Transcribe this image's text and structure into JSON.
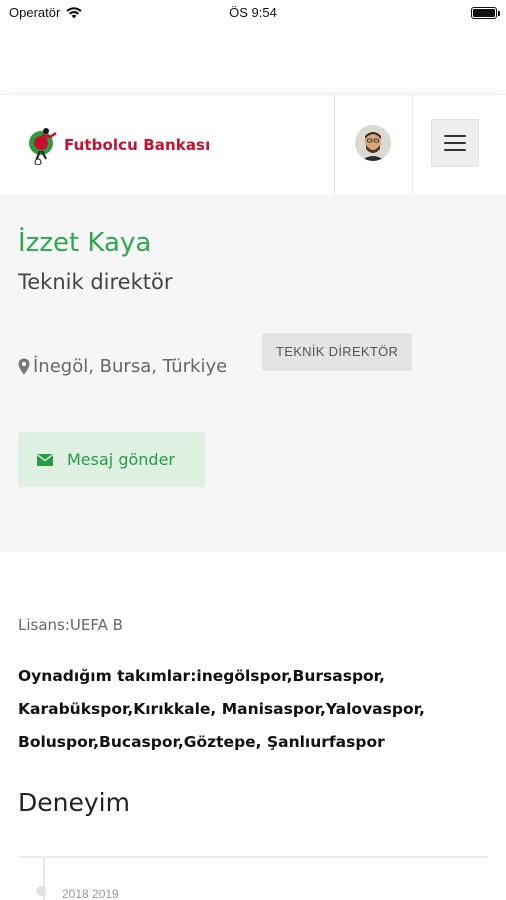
{
  "status_bar": {
    "carrier": "Operatör",
    "time": "ÖS 9:54"
  },
  "header": {
    "logo_text": "Futbolcu Bankası",
    "icons": {
      "menu": "hamburger-menu-icon",
      "avatar": "user-avatar"
    }
  },
  "profile": {
    "name": "İzzet Kaya",
    "role": "Teknik direktör",
    "location": "İnegöl, Bursa, Türkiye",
    "tag": "TEKNİK DİREKTÖR",
    "message_button": "Mesaj gönder"
  },
  "details": {
    "license": "Lisans:UEFA B",
    "teams_line1": "Oynadığım takımlar:inegölspor,Bursaspor,",
    "teams_line2": "Karabükspor,Kırıkkale, Manisaspor,Yalovaspor,",
    "teams_line3": "Boluspor,Bucaspor,Göztepe, Şanlıurfaspor"
  },
  "experience": {
    "title": "Deneyim",
    "first_date": "2018 2019"
  },
  "colors": {
    "brand_red": "#c8102e",
    "accent_green": "#2daa4e",
    "button_green_bg": "#ddf0e2"
  }
}
